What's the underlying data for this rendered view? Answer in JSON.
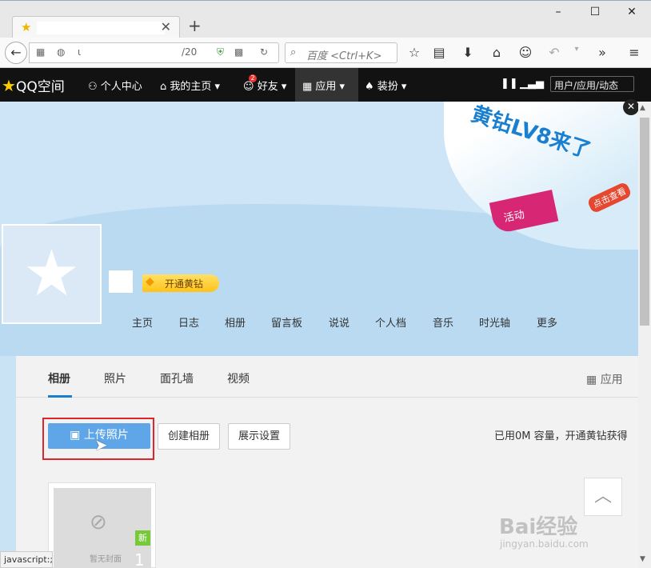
{
  "browser": {
    "tab_title": "",
    "new_tab": "+",
    "window_controls": {
      "minimize": "–",
      "maximize": "☐",
      "close": "✕"
    },
    "url_text": "ι",
    "url_suffix": "/20",
    "search_placeholder": "百度 <Ctrl+K>"
  },
  "qzone_bar": {
    "logo": "QQ空间",
    "items": [
      {
        "label": "个人中心"
      },
      {
        "label": "我的主页 ▾"
      },
      {
        "label": "好友 ▾"
      },
      {
        "label": "应用 ▾"
      },
      {
        "label": "装扮 ▾"
      }
    ],
    "friend_badge": "2",
    "dynamic": "用户/应用/动态"
  },
  "banner": {
    "title": "黄钻LV8来了",
    "tag": "活动",
    "view": "点击查看",
    "level": "LV8"
  },
  "profile": {
    "vip_label": "开通黄钻",
    "nav": [
      "主页",
      "日志",
      "相册",
      "留言板",
      "说说",
      "个人档",
      "音乐",
      "时光轴",
      "更多"
    ]
  },
  "album_page": {
    "tabs": [
      "相册",
      "照片",
      "面孔墙",
      "视频"
    ],
    "apps_label": "应用",
    "upload_label": "上传照片",
    "create_label": "创建相册",
    "display_label": "展示设置",
    "quota": "已用0M 容量，开通黄钻获得",
    "album": {
      "no_cover": "暂无封面",
      "new_tag": "新",
      "count": "1"
    }
  },
  "status_bar": "javascript:;",
  "watermark": {
    "main": "Bai经验",
    "sub": "jingyan.baidu.com"
  },
  "colors": {
    "accent": "#1a7fcf",
    "upload": "#5ea6e8",
    "highlight": "#e0242b",
    "vip": "#ffc31a"
  }
}
